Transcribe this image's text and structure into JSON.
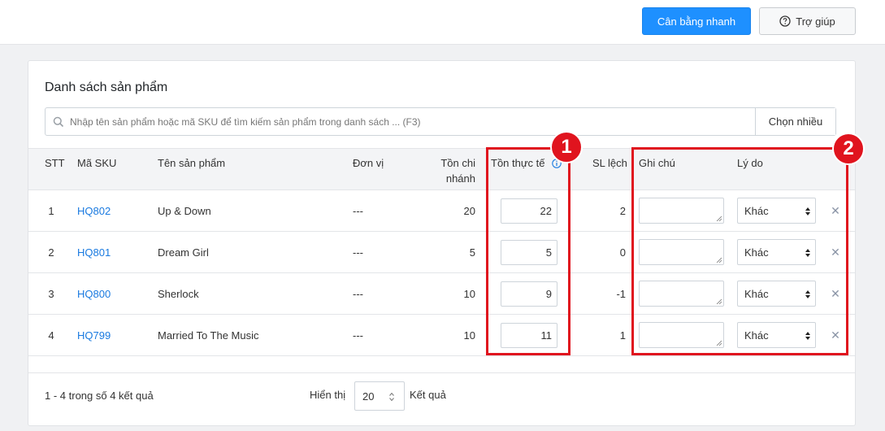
{
  "toolbar": {
    "quick_balance_label": "Cân bằng nhanh",
    "help_label": "Trợ giúp"
  },
  "card": {
    "title": "Danh sách sản phẩm",
    "search_placeholder": "Nhập tên sản phẩm hoặc mã SKU để tìm kiếm sản phẩm trong danh sách ... (F3)",
    "multi_select_label": "Chọn nhiều"
  },
  "table": {
    "headers": {
      "stt": "STT",
      "sku": "Mã SKU",
      "name": "Tên sản phẩm",
      "unit": "Đơn vị",
      "branch_stock_1": "Tồn chi",
      "branch_stock_2": "nhánh",
      "actual_stock": "Tồn thực tế",
      "diff": "SL lệch",
      "note": "Ghi chú",
      "reason": "Lý do"
    },
    "rows": [
      {
        "stt": "1",
        "sku": "HQ802",
        "name": "Up & Down",
        "unit": "---",
        "branch_stock": "20",
        "actual": "22",
        "diff": "2",
        "note": "",
        "reason": "Khác"
      },
      {
        "stt": "2",
        "sku": "HQ801",
        "name": "Dream Girl",
        "unit": "---",
        "branch_stock": "5",
        "actual": "5",
        "diff": "0",
        "note": "",
        "reason": "Khác"
      },
      {
        "stt": "3",
        "sku": "HQ800",
        "name": "Sherlock",
        "unit": "---",
        "branch_stock": "10",
        "actual": "9",
        "diff": "-1",
        "note": "",
        "reason": "Khác"
      },
      {
        "stt": "4",
        "sku": "HQ799",
        "name": "Married To The Music",
        "unit": "---",
        "branch_stock": "10",
        "actual": "11",
        "diff": "1",
        "note": "",
        "reason": "Khác"
      }
    ]
  },
  "footer": {
    "summary": "1 - 4 trong số 4 kết quả",
    "show_label": "Hiển thị",
    "page_size": "20",
    "results_label": "Kết quả"
  },
  "annotations": {
    "badge_1": "1",
    "badge_2": "2",
    "color": "#e0141e"
  },
  "colors": {
    "primary": "#1e90ff",
    "link": "#1a7ae0"
  },
  "icons": {
    "help": "question-circle-icon",
    "search": "search-icon",
    "info": "info-icon",
    "remove": "close-icon"
  }
}
